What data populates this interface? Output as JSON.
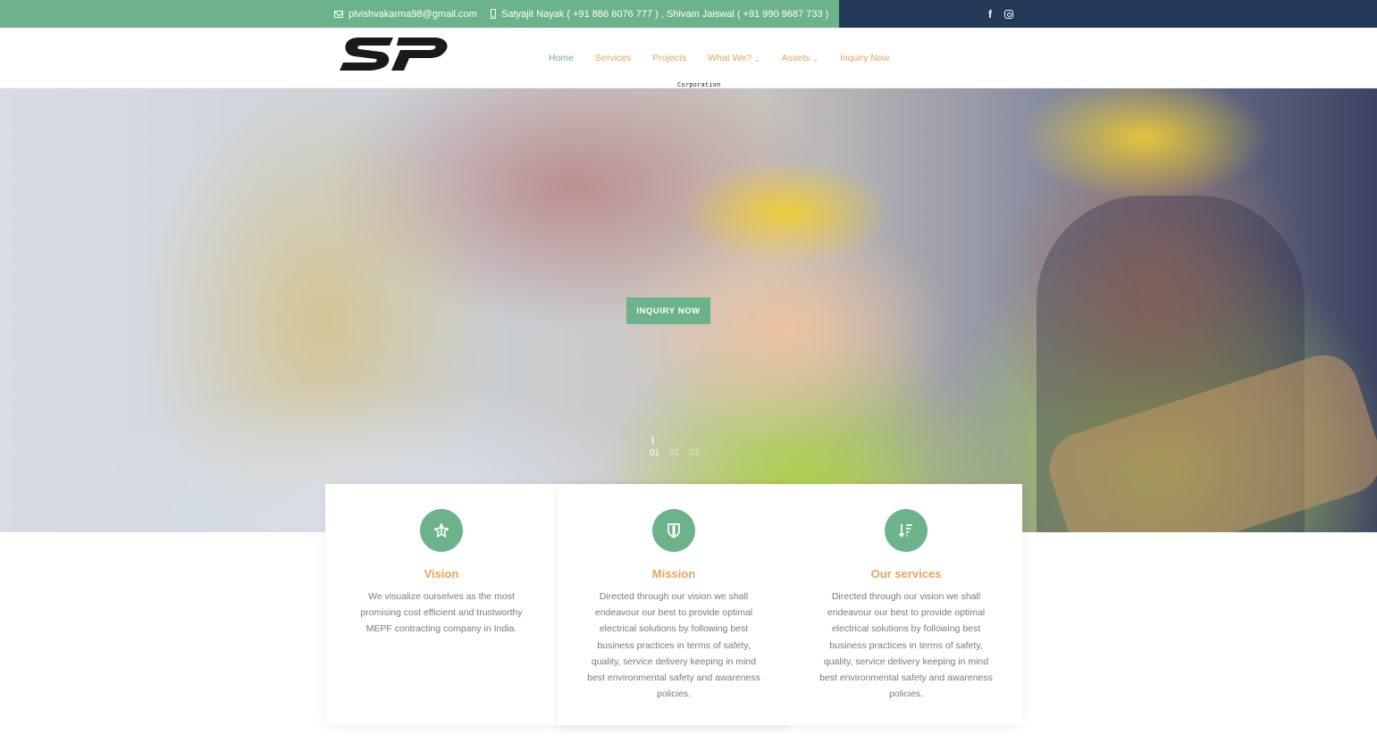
{
  "topbar": {
    "email": "plvishvakarma98@gmail.com",
    "phone": "Satyajit Nayak ( +91 886 6076 777 ) , Shivam Jaiswal ( +91 990 9687 733 )",
    "icons": [
      "mail-icon",
      "phone-icon",
      "facebook-icon",
      "instagram-icon"
    ],
    "colors": {
      "left_bg": "#6cb38b",
      "right_bg": "#233a58"
    }
  },
  "header": {
    "logo_subtitle": "Corporation India PVT.LTD.",
    "nav": [
      {
        "label": "Home",
        "active": true
      },
      {
        "label": "Services"
      },
      {
        "label": "Projects"
      },
      {
        "label": "What We?",
        "has_dropdown": true
      },
      {
        "label": "Assets",
        "has_dropdown": true
      },
      {
        "label": "Inquiry Now"
      }
    ],
    "colors": {
      "nav": "#e6a45d",
      "nav_active": "#6cb38b"
    }
  },
  "hero": {
    "button_label": "INQUIRY NOW",
    "slides": [
      "01",
      "02",
      "03"
    ],
    "active_slide": 0
  },
  "cards": [
    {
      "title": "Vision",
      "icon": "star-badge-icon",
      "text": "We visualize ourselves as the most promising cost efficient and trustworthy MEPF contracting company in India."
    },
    {
      "title": "Mission",
      "icon": "shield-icon",
      "text": "Directed through our vision we shall endeavour our best to provide optimal electrical solutions by following best business practices in terms of safety, quality, service delivery keeping in mind best environmental safety and awareness policies."
    },
    {
      "title": "Our services",
      "icon": "sort-list-icon",
      "text": "Directed through our vision we shall endeavour our best to provide optimal electrical solutions by following best business practices in terms of safety, quality, service delivery keeping in mind best environmental safety and awareness policies."
    }
  ],
  "colors": {
    "accent": "#6cb38b",
    "title": "#e6a45d"
  }
}
